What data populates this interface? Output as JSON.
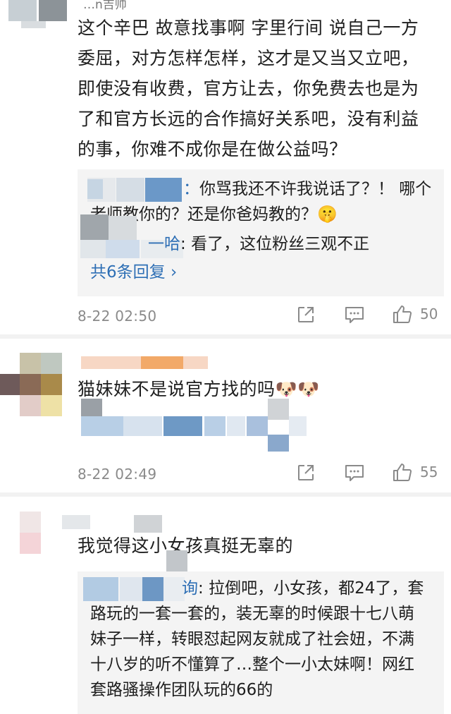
{
  "comments": [
    {
      "author_fragment": "…n吉帅",
      "text": "这个辛巴 故意找事啊 字里行间 说自己一方委屈，对方怎样怎样，这才是又当又立吧，即使没有收费，官方让去，你免费去也是为了和官方长远的合作搞好关系吧，没有利益的事，你难不成你是在做公益吗？",
      "lines": [
        "这个辛巴 故意找事啊 字里行间 说自己一方",
        "委屈，对方怎样怎样，这才是又当又立吧，",
        "即使没有收费，官方让去，你免费去也是为",
        "了和官方长远的合作搞好关系吧，没有利益",
        "的事，你难不成你是在做公益吗？"
      ],
      "replies": [
        {
          "name_tail": "：",
          "lines": [
            "你骂我还不许我说话了？！ 哪个",
            "老师教你的？还是你爸妈教的？🤫"
          ]
        },
        {
          "name_tail": "一哈",
          "lines": [
            "看了，这位粉丝三观不正"
          ]
        }
      ],
      "more_replies": "共6条回复 ›",
      "time": "8-22 02:50",
      "likes": "50"
    },
    {
      "text": "猫妹妹不是说官方找的吗🐶🐶",
      "time": "8-22 02:49",
      "likes": "55"
    },
    {
      "text": "我觉得这小女孩真挺无辜的",
      "replies": [
        {
          "name_tail": "询",
          "lines": [
            "拉倒吧，小女孩，都24了，套",
            "路玩的一套一套的，装无辜的时候跟十七八萌",
            "妹子一样，转眼怼起网友就成了社会妞，不满",
            "十八岁的听不懂算了…整个一小太妹啊！网红",
            "套路骚操作团队玩的66的"
          ]
        }
      ]
    }
  ],
  "icons": [
    "share-icon",
    "comment-icon",
    "like-icon"
  ],
  "colors": {
    "link": "#2e6fb5",
    "meta": "#8a8a8a",
    "reply_bg": "#f4f4f4"
  }
}
